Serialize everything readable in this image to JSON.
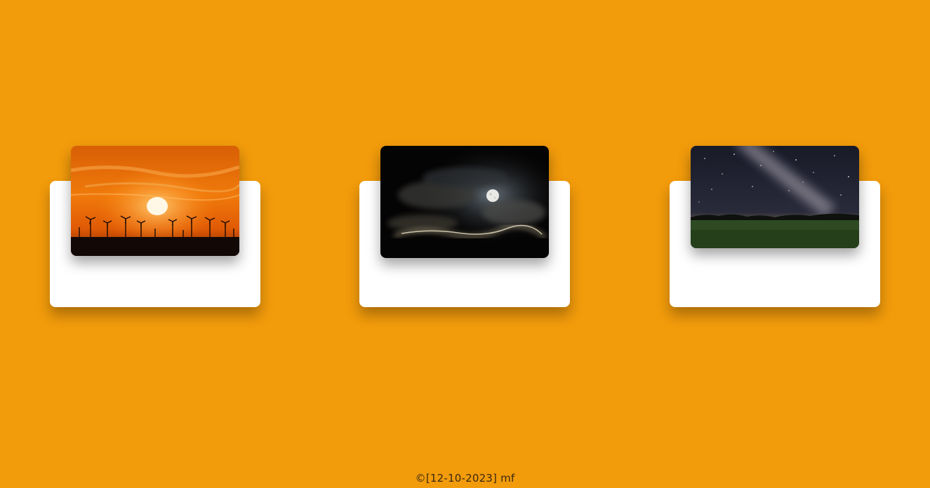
{
  "cards": [
    {
      "image": "sunset-wind-turbines-photo"
    },
    {
      "image": "full-moon-clouds-photo"
    },
    {
      "image": "milky-way-field-photo"
    }
  ],
  "footer": {
    "text": "©[12-10-2023] mf"
  },
  "colors": {
    "background": "#f29b0b",
    "card": "#ffffff"
  }
}
